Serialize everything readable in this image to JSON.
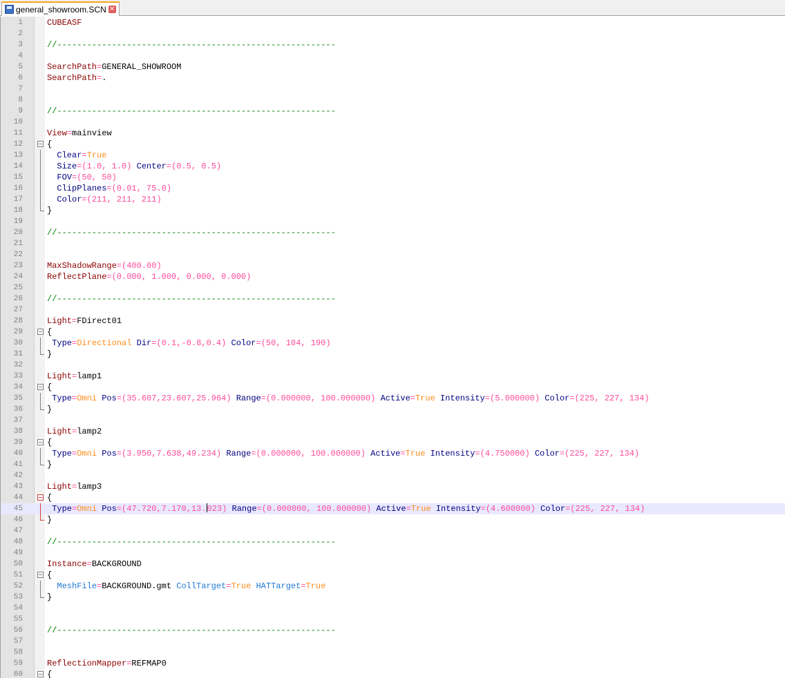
{
  "tab": {
    "filename": "general_showroom.SCN",
    "close_glyph": "✕",
    "icons": {
      "save": "floppy-disk-icon",
      "close": "close-icon"
    }
  },
  "editor": {
    "lines": [
      [
        {
          "t": "CUBEASF",
          "c": "k"
        }
      ],
      [],
      [
        {
          "t": "//--------------------------------------------------------",
          "c": "cmt"
        }
      ],
      [],
      [
        {
          "t": "SearchPath",
          "c": "k"
        },
        {
          "t": "=",
          "c": "op"
        },
        {
          "t": "GENERAL_SHOWROOM",
          "c": "p"
        }
      ],
      [
        {
          "t": "SearchPath",
          "c": "k"
        },
        {
          "t": "=",
          "c": "op"
        },
        {
          "t": ".",
          "c": "p"
        }
      ],
      [],
      [],
      [
        {
          "t": "//--------------------------------------------------------",
          "c": "cmt"
        }
      ],
      [],
      [
        {
          "t": "View",
          "c": "k"
        },
        {
          "t": "=",
          "c": "op"
        },
        {
          "t": "mainview",
          "c": "p"
        }
      ],
      [
        {
          "t": "{",
          "c": "p"
        }
      ],
      [
        {
          "t": "  ",
          "c": "p"
        },
        {
          "t": "Clear",
          "c": "kb"
        },
        {
          "t": "=",
          "c": "op"
        },
        {
          "t": "True",
          "c": "str"
        }
      ],
      [
        {
          "t": "  ",
          "c": "p"
        },
        {
          "t": "Size",
          "c": "kb"
        },
        {
          "t": "=(",
          "c": "op"
        },
        {
          "t": "1.0",
          "c": "num"
        },
        {
          "t": ", ",
          "c": "op"
        },
        {
          "t": "1.0",
          "c": "num"
        },
        {
          "t": ") ",
          "c": "op"
        },
        {
          "t": "Center",
          "c": "kb"
        },
        {
          "t": "=(",
          "c": "op"
        },
        {
          "t": "0.5",
          "c": "num"
        },
        {
          "t": ", ",
          "c": "op"
        },
        {
          "t": "0.5",
          "c": "num"
        },
        {
          "t": ")",
          "c": "op"
        }
      ],
      [
        {
          "t": "  ",
          "c": "p"
        },
        {
          "t": "FOV",
          "c": "kb"
        },
        {
          "t": "=(",
          "c": "op"
        },
        {
          "t": "50",
          "c": "num"
        },
        {
          "t": ", ",
          "c": "op"
        },
        {
          "t": "50",
          "c": "num"
        },
        {
          "t": ")",
          "c": "op"
        }
      ],
      [
        {
          "t": "  ",
          "c": "p"
        },
        {
          "t": "ClipPlanes",
          "c": "kb"
        },
        {
          "t": "=(",
          "c": "op"
        },
        {
          "t": "0.01",
          "c": "num"
        },
        {
          "t": ", ",
          "c": "op"
        },
        {
          "t": "75.0",
          "c": "num"
        },
        {
          "t": ")",
          "c": "op"
        }
      ],
      [
        {
          "t": "  ",
          "c": "p"
        },
        {
          "t": "Color",
          "c": "kb"
        },
        {
          "t": "=(",
          "c": "op"
        },
        {
          "t": "211",
          "c": "num"
        },
        {
          "t": ", ",
          "c": "op"
        },
        {
          "t": "211",
          "c": "num"
        },
        {
          "t": ", ",
          "c": "op"
        },
        {
          "t": "211",
          "c": "num"
        },
        {
          "t": ")",
          "c": "op"
        }
      ],
      [
        {
          "t": "}",
          "c": "p"
        }
      ],
      [],
      [
        {
          "t": "//--------------------------------------------------------",
          "c": "cmt"
        }
      ],
      [],
      [],
      [
        {
          "t": "MaxShadowRange",
          "c": "k"
        },
        {
          "t": "=(",
          "c": "op"
        },
        {
          "t": "400.00",
          "c": "num"
        },
        {
          "t": ")",
          "c": "op"
        }
      ],
      [
        {
          "t": "ReflectPlane",
          "c": "k"
        },
        {
          "t": "=(",
          "c": "op"
        },
        {
          "t": "0.000",
          "c": "num"
        },
        {
          "t": ", ",
          "c": "op"
        },
        {
          "t": "1.000",
          "c": "num"
        },
        {
          "t": ", ",
          "c": "op"
        },
        {
          "t": "0.000",
          "c": "num"
        },
        {
          "t": ", ",
          "c": "op"
        },
        {
          "t": "0.000",
          "c": "num"
        },
        {
          "t": ")",
          "c": "op"
        }
      ],
      [],
      [
        {
          "t": "//--------------------------------------------------------",
          "c": "cmt"
        }
      ],
      [],
      [
        {
          "t": "Light",
          "c": "k"
        },
        {
          "t": "=",
          "c": "op"
        },
        {
          "t": "FDirect01",
          "c": "p"
        }
      ],
      [
        {
          "t": "{",
          "c": "p"
        }
      ],
      [
        {
          "t": " ",
          "c": "p"
        },
        {
          "t": "Type",
          "c": "kb"
        },
        {
          "t": "=",
          "c": "op"
        },
        {
          "t": "Directional",
          "c": "str"
        },
        {
          "t": " ",
          "c": "p"
        },
        {
          "t": "Dir",
          "c": "kb"
        },
        {
          "t": "=(",
          "c": "op"
        },
        {
          "t": "0.1",
          "c": "num"
        },
        {
          "t": ",",
          "c": "op"
        },
        {
          "t": "-0.8",
          "c": "num"
        },
        {
          "t": ",",
          "c": "op"
        },
        {
          "t": "0.4",
          "c": "num"
        },
        {
          "t": ") ",
          "c": "op"
        },
        {
          "t": "Color",
          "c": "kb"
        },
        {
          "t": "=(",
          "c": "op"
        },
        {
          "t": "50",
          "c": "num"
        },
        {
          "t": ", ",
          "c": "op"
        },
        {
          "t": "104",
          "c": "num"
        },
        {
          "t": ", ",
          "c": "op"
        },
        {
          "t": "190",
          "c": "num"
        },
        {
          "t": ")",
          "c": "op"
        }
      ],
      [
        {
          "t": "}",
          "c": "p"
        }
      ],
      [],
      [
        {
          "t": "Light",
          "c": "k"
        },
        {
          "t": "=",
          "c": "op"
        },
        {
          "t": "lamp1",
          "c": "p"
        }
      ],
      [
        {
          "t": "{",
          "c": "p"
        }
      ],
      [
        {
          "t": " ",
          "c": "p"
        },
        {
          "t": "Type",
          "c": "kb"
        },
        {
          "t": "=",
          "c": "op"
        },
        {
          "t": "Omni",
          "c": "str"
        },
        {
          "t": " ",
          "c": "p"
        },
        {
          "t": "Pos",
          "c": "kb"
        },
        {
          "t": "=(",
          "c": "op"
        },
        {
          "t": "35.607",
          "c": "num"
        },
        {
          "t": ",",
          "c": "op"
        },
        {
          "t": "23.607",
          "c": "num"
        },
        {
          "t": ",",
          "c": "op"
        },
        {
          "t": "25.964",
          "c": "num"
        },
        {
          "t": ") ",
          "c": "op"
        },
        {
          "t": "Range",
          "c": "kb"
        },
        {
          "t": "=(",
          "c": "op"
        },
        {
          "t": "0.000000",
          "c": "num"
        },
        {
          "t": ", ",
          "c": "op"
        },
        {
          "t": "100.000000",
          "c": "num"
        },
        {
          "t": ") ",
          "c": "op"
        },
        {
          "t": "Active",
          "c": "kb"
        },
        {
          "t": "=",
          "c": "op"
        },
        {
          "t": "True",
          "c": "str"
        },
        {
          "t": " ",
          "c": "p"
        },
        {
          "t": "Intensity",
          "c": "kb"
        },
        {
          "t": "=(",
          "c": "op"
        },
        {
          "t": "5.000000",
          "c": "num"
        },
        {
          "t": ") ",
          "c": "op"
        },
        {
          "t": "Color",
          "c": "kb"
        },
        {
          "t": "=(",
          "c": "op"
        },
        {
          "t": "225",
          "c": "num"
        },
        {
          "t": ", ",
          "c": "op"
        },
        {
          "t": "227",
          "c": "num"
        },
        {
          "t": ", ",
          "c": "op"
        },
        {
          "t": "134",
          "c": "num"
        },
        {
          "t": ")",
          "c": "op"
        }
      ],
      [
        {
          "t": "}",
          "c": "p"
        }
      ],
      [],
      [
        {
          "t": "Light",
          "c": "k"
        },
        {
          "t": "=",
          "c": "op"
        },
        {
          "t": "lamp2",
          "c": "p"
        }
      ],
      [
        {
          "t": "{",
          "c": "p"
        }
      ],
      [
        {
          "t": " ",
          "c": "p"
        },
        {
          "t": "Type",
          "c": "kb"
        },
        {
          "t": "=",
          "c": "op"
        },
        {
          "t": "Omni",
          "c": "str"
        },
        {
          "t": " ",
          "c": "p"
        },
        {
          "t": "Pos",
          "c": "kb"
        },
        {
          "t": "=(",
          "c": "op"
        },
        {
          "t": "3.950",
          "c": "num"
        },
        {
          "t": ",",
          "c": "op"
        },
        {
          "t": "7.638",
          "c": "num"
        },
        {
          "t": ",",
          "c": "op"
        },
        {
          "t": "49.234",
          "c": "num"
        },
        {
          "t": ") ",
          "c": "op"
        },
        {
          "t": "Range",
          "c": "kb"
        },
        {
          "t": "=(",
          "c": "op"
        },
        {
          "t": "0.000000",
          "c": "num"
        },
        {
          "t": ", ",
          "c": "op"
        },
        {
          "t": "100.000000",
          "c": "num"
        },
        {
          "t": ") ",
          "c": "op"
        },
        {
          "t": "Active",
          "c": "kb"
        },
        {
          "t": "=",
          "c": "op"
        },
        {
          "t": "True",
          "c": "str"
        },
        {
          "t": " ",
          "c": "p"
        },
        {
          "t": "Intensity",
          "c": "kb"
        },
        {
          "t": "=(",
          "c": "op"
        },
        {
          "t": "4.750000",
          "c": "num"
        },
        {
          "t": ") ",
          "c": "op"
        },
        {
          "t": "Color",
          "c": "kb"
        },
        {
          "t": "=(",
          "c": "op"
        },
        {
          "t": "225",
          "c": "num"
        },
        {
          "t": ", ",
          "c": "op"
        },
        {
          "t": "227",
          "c": "num"
        },
        {
          "t": ", ",
          "c": "op"
        },
        {
          "t": "134",
          "c": "num"
        },
        {
          "t": ")",
          "c": "op"
        }
      ],
      [
        {
          "t": "}",
          "c": "p"
        }
      ],
      [],
      [
        {
          "t": "Light",
          "c": "k"
        },
        {
          "t": "=",
          "c": "op"
        },
        {
          "t": "lamp3",
          "c": "p"
        }
      ],
      [
        {
          "t": "{",
          "c": "p"
        }
      ],
      [
        {
          "t": " ",
          "c": "p"
        },
        {
          "t": "Type",
          "c": "kb"
        },
        {
          "t": "=",
          "c": "op"
        },
        {
          "t": "Omni",
          "c": "str"
        },
        {
          "t": " ",
          "c": "p"
        },
        {
          "t": "Pos",
          "c": "kb"
        },
        {
          "t": "=(",
          "c": "op"
        },
        {
          "t": "47.720",
          "c": "num"
        },
        {
          "t": ",",
          "c": "op"
        },
        {
          "t": "7.170",
          "c": "num"
        },
        {
          "t": ",",
          "c": "op"
        },
        {
          "t": "13.",
          "c": "num"
        },
        {
          "t": "",
          "c": "caret"
        },
        {
          "t": "023",
          "c": "num"
        },
        {
          "t": ") ",
          "c": "op"
        },
        {
          "t": "Range",
          "c": "kb"
        },
        {
          "t": "=(",
          "c": "op"
        },
        {
          "t": "0.000000",
          "c": "num"
        },
        {
          "t": ", ",
          "c": "op"
        },
        {
          "t": "100.000000",
          "c": "num"
        },
        {
          "t": ") ",
          "c": "op"
        },
        {
          "t": "Active",
          "c": "kb"
        },
        {
          "t": "=",
          "c": "op"
        },
        {
          "t": "True",
          "c": "str"
        },
        {
          "t": " ",
          "c": "p"
        },
        {
          "t": "Intensity",
          "c": "kb"
        },
        {
          "t": "=(",
          "c": "op"
        },
        {
          "t": "4.600000",
          "c": "num"
        },
        {
          "t": ") ",
          "c": "op"
        },
        {
          "t": "Color",
          "c": "kb"
        },
        {
          "t": "=(",
          "c": "op"
        },
        {
          "t": "225",
          "c": "num"
        },
        {
          "t": ", ",
          "c": "op"
        },
        {
          "t": "227",
          "c": "num"
        },
        {
          "t": ", ",
          "c": "op"
        },
        {
          "t": "134",
          "c": "num"
        },
        {
          "t": ")",
          "c": "op"
        }
      ],
      [
        {
          "t": "}",
          "c": "p"
        }
      ],
      [],
      [
        {
          "t": "//--------------------------------------------------------",
          "c": "cmt"
        }
      ],
      [],
      [
        {
          "t": "Instance",
          "c": "k"
        },
        {
          "t": "=",
          "c": "op"
        },
        {
          "t": "BACKGROUND",
          "c": "p"
        }
      ],
      [
        {
          "t": "{",
          "c": "p"
        }
      ],
      [
        {
          "t": "  ",
          "c": "p"
        },
        {
          "t": "MeshFile",
          "c": "kc"
        },
        {
          "t": "=",
          "c": "op"
        },
        {
          "t": "BACKGROUND.gmt",
          "c": "p"
        },
        {
          "t": " ",
          "c": "p"
        },
        {
          "t": "CollTarget",
          "c": "kc"
        },
        {
          "t": "=",
          "c": "op"
        },
        {
          "t": "True",
          "c": "str"
        },
        {
          "t": " ",
          "c": "p"
        },
        {
          "t": "HATTarget",
          "c": "kc"
        },
        {
          "t": "=",
          "c": "op"
        },
        {
          "t": "True",
          "c": "str"
        }
      ],
      [
        {
          "t": "}",
          "c": "p"
        }
      ],
      [],
      [],
      [
        {
          "t": "//--------------------------------------------------------",
          "c": "cmt"
        }
      ],
      [],
      [],
      [
        {
          "t": "ReflectionMapper",
          "c": "k"
        },
        {
          "t": "=",
          "c": "op"
        },
        {
          "t": "REFMAP0",
          "c": "p"
        }
      ],
      [
        {
          "t": "{",
          "c": "p"
        }
      ]
    ],
    "current_line": 45,
    "folds": [
      {
        "start": 12,
        "end": 18
      },
      {
        "start": 29,
        "end": 31
      },
      {
        "start": 34,
        "end": 36
      },
      {
        "start": 39,
        "end": 41
      },
      {
        "start": 44,
        "end": 46,
        "active": true
      },
      {
        "start": 51,
        "end": 53
      },
      {
        "start": 60,
        "end": null
      }
    ]
  }
}
